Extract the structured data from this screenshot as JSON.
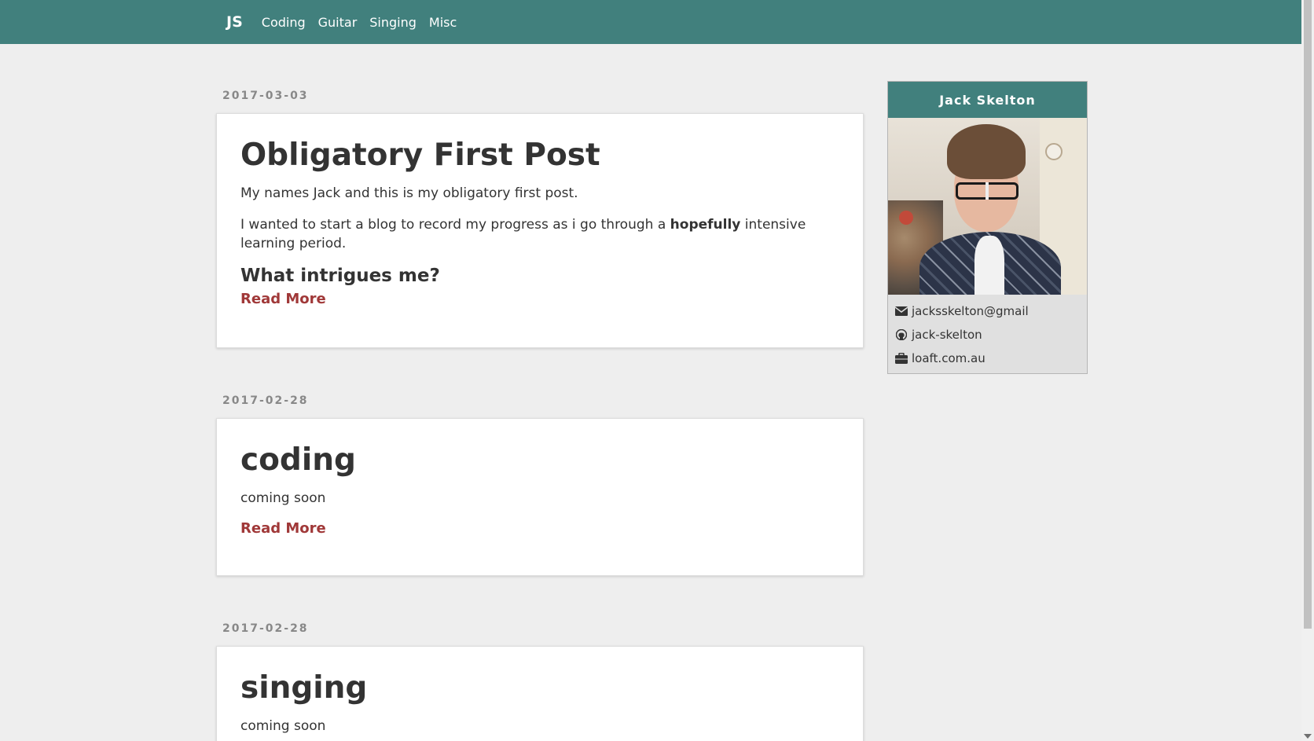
{
  "nav": {
    "brand": "JS",
    "links": [
      "Coding",
      "Guitar",
      "Singing",
      "Misc"
    ]
  },
  "posts": [
    {
      "date": "2017-03-03",
      "title": "Obligatory First Post",
      "para1": "My names Jack and this is my obligatory first post.",
      "para2_before": "I wanted to start a blog to record my progress as i go through a ",
      "para2_bold": "hopefully",
      "para2_after": " intensive learning period.",
      "subheading": "What intrigues me?",
      "read_more": "Read More"
    },
    {
      "date": "2017-02-28",
      "title": "coding",
      "para1": "coming soon",
      "read_more": "Read More"
    },
    {
      "date": "2017-02-28",
      "title": "singing",
      "para1": "coming soon"
    }
  ],
  "sidebar": {
    "name": "Jack Skelton",
    "email": "jacksskelton@gmail",
    "github": "jack-skelton",
    "website": "loaft.com.au",
    "icons": {
      "email": "envelope-icon",
      "github": "github-icon",
      "website": "briefcase-icon"
    }
  },
  "colors": {
    "navbar": "#41807d",
    "background": "#eeeeee",
    "link": "#a03838"
  }
}
